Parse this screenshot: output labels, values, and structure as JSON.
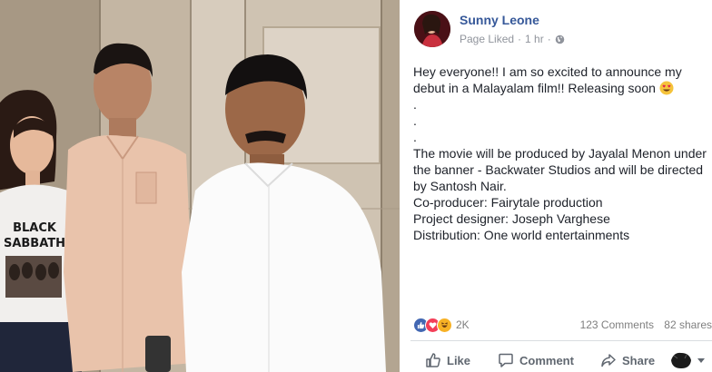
{
  "post": {
    "page_name": "Sunny Leone",
    "page_status": "Page Liked",
    "time": "1 hr",
    "visibility_icon": "globe-icon",
    "paragraphs": [
      "Hey everyone!! I am so excited to announce my debut in a Malayalam film!! Releasing soon",
      ".",
      ".",
      ".",
      "The movie will be produced by Jayalal Menon under the banner - Backwater Studios and will be directed by Santosh Nair.",
      "Co-producer: Fairytale production",
      "Project designer: Joseph Varghese",
      "Distribution: One world entertainments"
    ],
    "emoji": "heart-eyes-emoji"
  },
  "photo": {
    "shirt_print_line1": "BLACK",
    "shirt_print_line2": "SABBATH"
  },
  "engagement": {
    "reaction_icons": [
      "like-icon",
      "love-icon",
      "haha-icon"
    ],
    "reaction_count": "2K",
    "comments": "123 Comments",
    "shares": "82 shares"
  },
  "actions": {
    "like_label": "Like",
    "comment_label": "Comment",
    "share_label": "Share"
  },
  "colors": {
    "link_blue": "#365899",
    "meta_grey": "#90949c",
    "like_blue": "#4267b2",
    "love_red": "#f33e58",
    "haha_yellow": "#f7b125"
  }
}
